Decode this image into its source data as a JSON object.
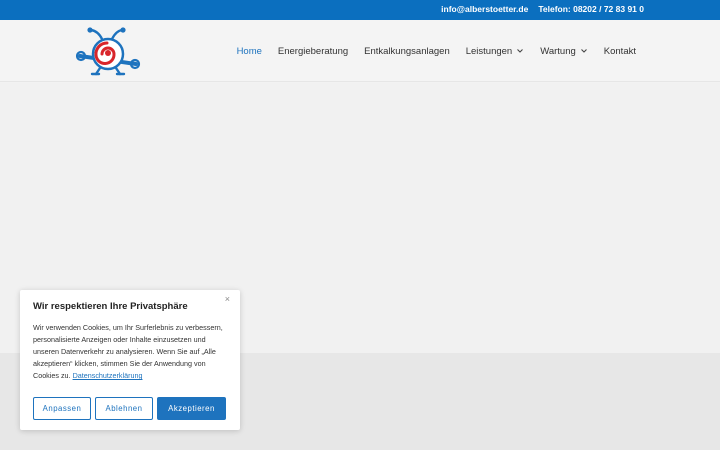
{
  "topbar": {
    "email": "info@alberstoetter.de",
    "phone": "Telefon: 08202 / 72 83 91 0"
  },
  "nav": {
    "items": [
      {
        "label": "Home"
      },
      {
        "label": "Energieberatung"
      },
      {
        "label": "Entkalkungsanlagen"
      },
      {
        "label": "Leistungen"
      },
      {
        "label": "Wartung"
      },
      {
        "label": "Kontakt"
      }
    ]
  },
  "cookie": {
    "close": "×",
    "title": "Wir respektieren Ihre Privatsphäre",
    "text": "Wir verwenden Cookies, um Ihr Surferlebnis zu verbessern, personalisierte Anzeigen oder Inhalte einzusetzen und unseren Datenverkehr zu analysieren. Wenn Sie auf „Alle akzeptieren“ klicken, stimmen Sie der Anwendung von Cookies zu.",
    "link": "Datenschutzerklärung",
    "buttons": {
      "customize": "Anpassen",
      "reject": "Ablehnen",
      "accept": "Akzeptieren"
    }
  },
  "colors": {
    "brand_blue": "#0b6fbf",
    "accent": "#1e73be",
    "logo_red": "#d9262b"
  }
}
